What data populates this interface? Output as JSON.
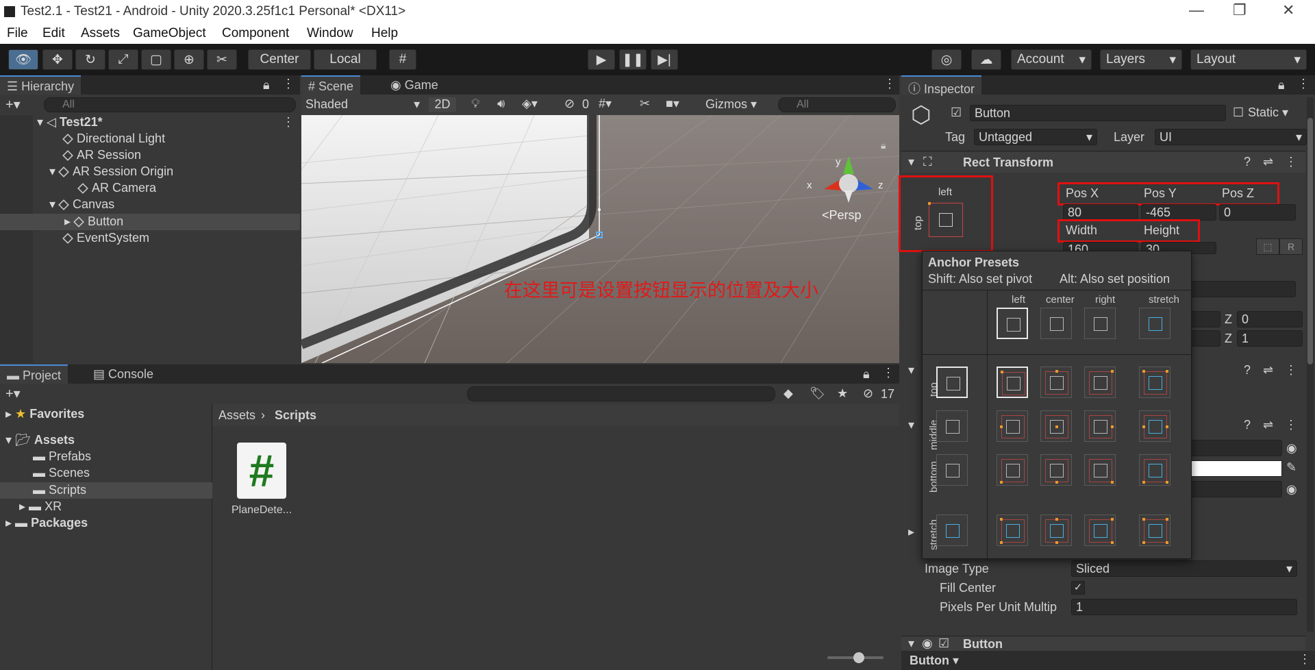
{
  "window": {
    "title": "Test2.1 - Test21 - Android - Unity 2020.3.25f1c1 Personal* <DX11>",
    "controls": [
      "—",
      "❐",
      "✕"
    ]
  },
  "menu": [
    "File",
    "Edit",
    "Assets",
    "GameObject",
    "Component",
    "Window",
    "Help"
  ],
  "toolbar": {
    "center_label": "Center",
    "local_label": "Local",
    "account_label": "Account",
    "layers_label": "Layers",
    "layout_label": "Layout"
  },
  "hierarchy": {
    "tab_label": "Hierarchy",
    "search_placeholder": "All",
    "scene": "Test21*",
    "items": [
      "Directional Light",
      "AR Session",
      "AR Session Origin",
      "AR Camera",
      "Canvas",
      "Button",
      "EventSystem"
    ]
  },
  "scene_view": {
    "tab_scene": "Scene",
    "tab_game": "Game",
    "shading": "Shaded",
    "mode_2d": "2D",
    "hidden_count": "0",
    "gizmos_label": "Gizmos",
    "search_placeholder": "All",
    "persp_label": "Persp",
    "axis_x": "x",
    "axis_y": "y",
    "axis_z": "z",
    "annotation": "在这里可是设置按钮显示的位置及大小"
  },
  "project": {
    "tab_project": "Project",
    "tab_console": "Console",
    "hidden_count": "17",
    "tree": [
      "Favorites",
      "Assets",
      "Prefabs",
      "Scenes",
      "Scripts",
      "XR",
      "Packages"
    ],
    "breadcrumb_root": "Assets",
    "breadcrumb_current": "Scripts",
    "file_name": "PlaneDete...",
    "file_icon_glyph": "#"
  },
  "inspector": {
    "tab_label": "Inspector",
    "object_name": "Button",
    "static_label": "Static",
    "tag_label": "Tag",
    "tag_value": "Untagged",
    "layer_label": "Layer",
    "layer_value": "UI",
    "rect_transform_title": "Rect Transform",
    "anchor_h": "left",
    "anchor_v": "top",
    "pos_x_label": "Pos X",
    "pos_y_label": "Pos Y",
    "pos_z_label": "Pos Z",
    "pos_x": "80",
    "pos_y": "-465",
    "pos_z": "0",
    "width_label": "Width",
    "height_label": "Height",
    "width": "160",
    "height": "30",
    "r_label": "R",
    "z_label_1": "Z",
    "z_value_1": "0",
    "z_label_2": "Z",
    "z_value_2": "1",
    "image_type_label": "Image Type",
    "image_type_value": "Sliced",
    "fill_center_label": "Fill Center",
    "ppu_label": "Pixels Per Unit Multip",
    "ppu_value": "1",
    "button_component": "Button",
    "footer_label": "Button"
  },
  "anchor_presets": {
    "title": "Anchor Presets",
    "hint_pivot": "Shift: Also set pivot",
    "hint_position": "Alt: Also set position",
    "columns": [
      "left",
      "center",
      "right",
      "stretch"
    ],
    "rows": [
      "top",
      "middle",
      "bottom",
      "stretch"
    ]
  },
  "colors": {
    "accent": "#4c89d8",
    "highlight_red": "#e01010",
    "annotation_red": "#e01a1a"
  }
}
